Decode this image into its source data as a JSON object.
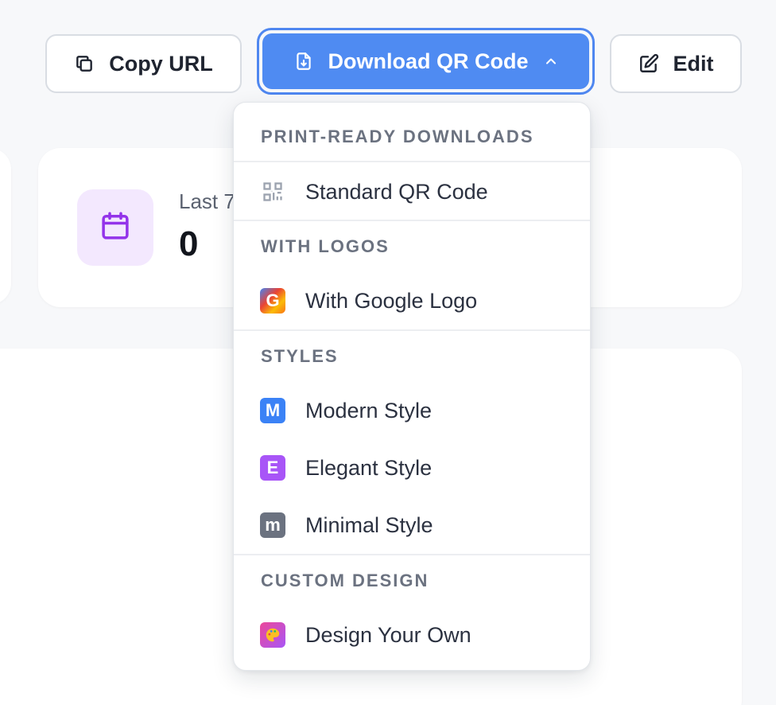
{
  "toolbar": {
    "copy_label": "Copy URL",
    "download_label": "Download QR Code",
    "edit_label": "Edit"
  },
  "stats": {
    "label": "Last 7",
    "value": "0"
  },
  "dropdown": {
    "sections": [
      {
        "title": "PRINT-READY DOWNLOADS",
        "items": [
          {
            "label": "Standard QR Code",
            "icon": "qr-code-icon"
          }
        ]
      },
      {
        "title": "WITH LOGOS",
        "items": [
          {
            "label": "With Google Logo",
            "icon": "google-logo-icon",
            "badge": "G"
          }
        ]
      },
      {
        "title": "STYLES",
        "items": [
          {
            "label": "Modern Style",
            "icon": "modern-style-icon",
            "badge": "M",
            "color": "#3b82f6"
          },
          {
            "label": "Elegant Style",
            "icon": "elegant-style-icon",
            "badge": "E",
            "color": "#a855f7"
          },
          {
            "label": "Minimal Style",
            "icon": "minimal-style-icon",
            "badge": "m",
            "color": "#6b7280"
          }
        ]
      },
      {
        "title": "CUSTOM DESIGN",
        "items": [
          {
            "label": "Design Your Own",
            "icon": "palette-icon"
          }
        ]
      }
    ]
  },
  "colors": {
    "primary": "#4f8bf2",
    "stat_icon_bg": "#f3e8fe",
    "stat_icon": "#9333ea"
  }
}
